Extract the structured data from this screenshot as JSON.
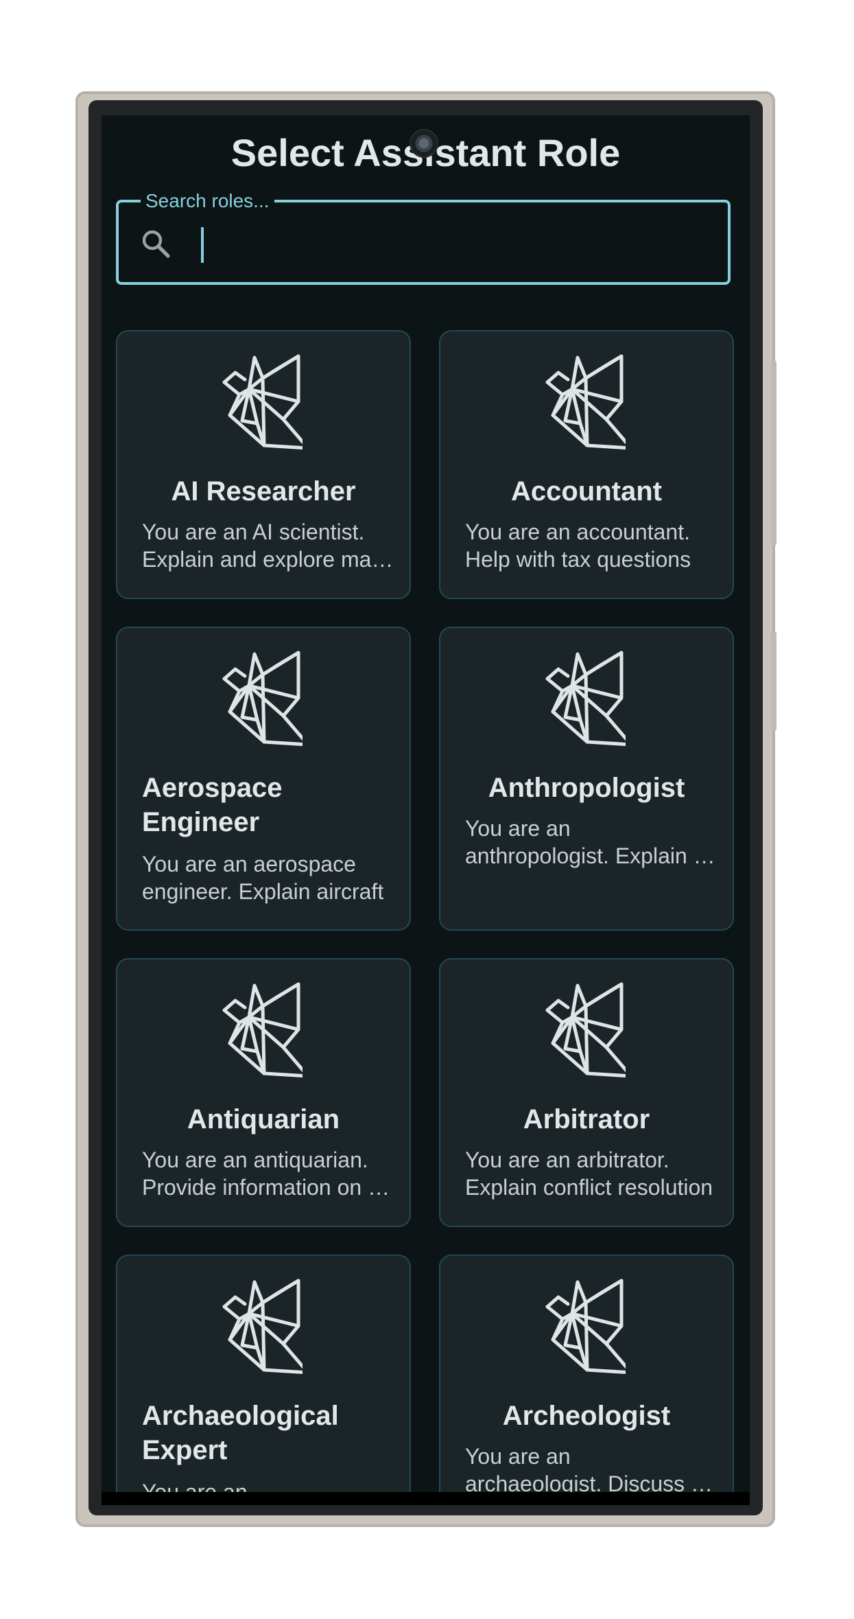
{
  "screen": {
    "title": "Select Assistant Role",
    "search": {
      "label": "Search roles...",
      "value": ""
    }
  },
  "roles": [
    {
      "title": "AI Researcher",
      "desc_line1": "You are an AI scientist.",
      "desc_line2": "Explain and explore machine learning"
    },
    {
      "title": "Accountant",
      "desc_line1": "You are an accountant.",
      "desc_line2": "Help with tax questions"
    },
    {
      "title_line1": "Aerospace",
      "title_line2": "Engineer",
      "desc_line1": "You are an aerospace",
      "desc_line2": "engineer. Explain aircraft"
    },
    {
      "title": "Anthropologist",
      "desc_line1": "You are an",
      "desc_line2": "anthropologist. Explain cultures"
    },
    {
      "title": "Antiquarian",
      "desc_line1": "You are an antiquarian.",
      "desc_line2": "Provide information on antiques"
    },
    {
      "title": "Arbitrator",
      "desc_line1": "You are an arbitrator.",
      "desc_line2": "Explain conflict resolution"
    },
    {
      "title_line1": "Archaeological",
      "title_line2": "Expert",
      "desc_line1": "You are an"
    },
    {
      "title": "Archeologist",
      "desc_line1": "You are an",
      "desc_line2": "archaeologist. Discuss history"
    }
  ],
  "icons": {
    "search": "search-icon",
    "role": "origami-bird-icon"
  },
  "colors": {
    "accent": "#86d0de",
    "background": "#0d1416",
    "card": "#1b2528",
    "card_border": "#1f4a55",
    "text": "#e3e7ea"
  }
}
